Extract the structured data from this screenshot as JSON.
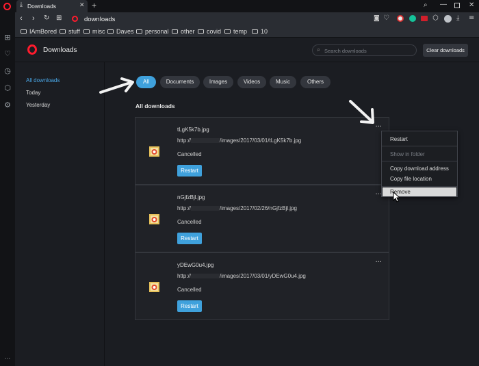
{
  "browser": {
    "tab_title": "Downloads",
    "address": "downloads"
  },
  "bookmarks": [
    "IAmBored",
    "stuff",
    "misc",
    "Daves",
    "personal",
    "other",
    "covid",
    "temp",
    "10"
  ],
  "page": {
    "title": "Downloads",
    "search_placeholder": "Search downloads",
    "clear_button": "Clear downloads",
    "nav": [
      "All downloads",
      "Today",
      "Yesterday"
    ],
    "filters": [
      "All",
      "Documents",
      "Images",
      "Videos",
      "Music",
      "Others"
    ],
    "section_title": "All downloads"
  },
  "downloads": [
    {
      "name": "tLgK5k7b.jpg",
      "url_prefix": "http://",
      "url_suffix": "/images/2017/03/01/tLgK5k7b.jpg",
      "status": "Cancelled",
      "button": "Restart"
    },
    {
      "name": "nGjfzBjl.jpg",
      "url_prefix": "http://",
      "url_suffix": "/images/2017/02/26/nGjfzBjl.jpg",
      "status": "Cancelled",
      "button": "Restart"
    },
    {
      "name": "yDEwG0u4.jpg",
      "url_prefix": "http://",
      "url_suffix": "/images/2017/03/01/yDEwG0u4.jpg",
      "status": "Cancelled",
      "button": "Restart"
    }
  ],
  "context_menu": {
    "items": [
      "Restart",
      "Show in folder",
      "Copy download address",
      "Copy file location",
      "Remove"
    ]
  },
  "colors": {
    "accent": "#3fa1dc",
    "opera_red": "#ff1b2d"
  }
}
